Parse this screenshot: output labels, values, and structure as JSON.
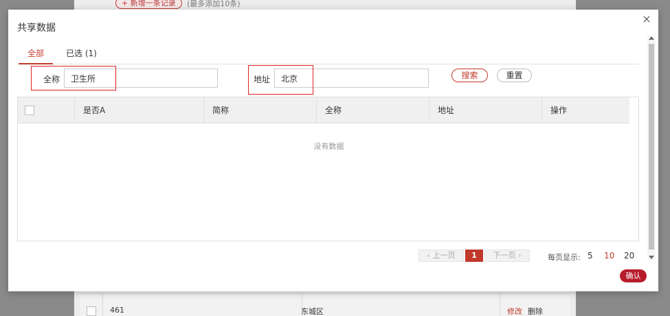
{
  "background": {
    "add_button": "+ 新增一条记录",
    "add_hint": "(最多添加10条)",
    "row": {
      "id": "461",
      "district": "东城区",
      "edit": "修改",
      "delete": "删除"
    }
  },
  "modal": {
    "title": "共享数据",
    "close_icon": "×",
    "tabs": [
      {
        "label": "全部",
        "active": true
      },
      {
        "label": "已选 (1)",
        "active": false
      }
    ],
    "filters": {
      "fullname_label": "全称",
      "fullname_value": "卫生所",
      "address_label": "地址",
      "address_value": "北京",
      "search_label": "搜索",
      "reset_label": "重置"
    },
    "table": {
      "columns": [
        "是否A",
        "简称",
        "全称",
        "地址",
        "操作"
      ],
      "empty_text": "没有数据"
    },
    "pagination": {
      "prev": "‹ 上一页",
      "current_page": "1",
      "next": "下一页 ›",
      "page_size_label": "每页显示:",
      "page_sizes": [
        "5",
        "10",
        "20"
      ],
      "selected_size": "10"
    },
    "confirm_label": "确认"
  },
  "colors": {
    "accent": "#c0392b",
    "confirm_bg": "#b71c2c",
    "highlight": "#e02020"
  }
}
